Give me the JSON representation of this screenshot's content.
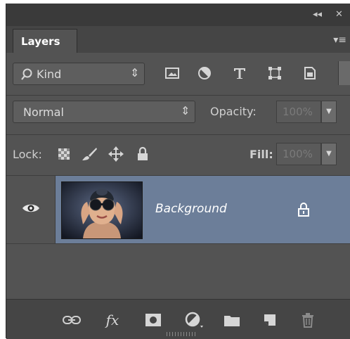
{
  "window": {
    "collapse_glyph": "◂◂",
    "close_glyph": "✕"
  },
  "panel": {
    "tab_label": "Layers",
    "menu_glyph": "▾≡"
  },
  "filter": {
    "kind_label": "Kind",
    "icons": [
      "search-icon",
      "pixel-layer-filter-icon",
      "adjustment-layer-filter-icon",
      "type-layer-filter-icon",
      "shape-layer-filter-icon",
      "smart-object-filter-icon"
    ]
  },
  "blend": {
    "mode": "Normal",
    "opacity_label": "Opacity:",
    "opacity_value": "100%"
  },
  "lock": {
    "label": "Lock:",
    "fill_label": "Fill:",
    "fill_value": "100%",
    "icons": [
      "lock-transparent-pixels-icon",
      "lock-image-pixels-icon",
      "lock-position-icon",
      "lock-all-icon"
    ]
  },
  "layers": [
    {
      "name": "Background",
      "visible": true,
      "locked": true,
      "selected": true
    }
  ],
  "bottom_icons": [
    "link-layers-icon",
    "layer-style-icon",
    "add-mask-icon",
    "new-fill-adjustment-icon",
    "new-group-icon",
    "new-layer-icon",
    "delete-layer-icon"
  ],
  "bottom_labels": {
    "fx": "fx"
  },
  "colors": {
    "panel_bg": "#535353",
    "selected_layer": "#6c7e99",
    "dark_bar": "#454545"
  }
}
